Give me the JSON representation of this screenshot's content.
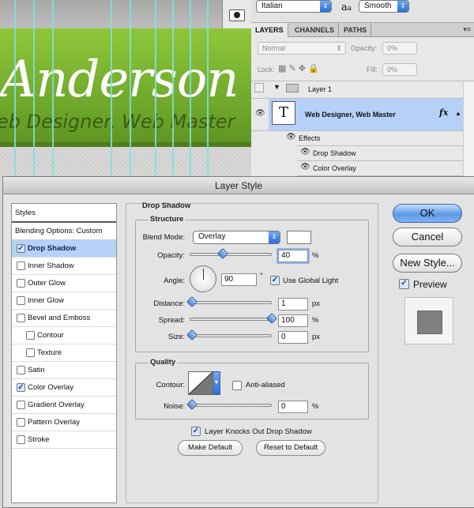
{
  "canvas": {
    "name_text": "Anderson",
    "subtitle_text": "eb Designer, Web Master"
  },
  "charbar": {
    "font_style": "Italian",
    "aa_symbol": "a",
    "aa_sub": "a",
    "antialias": "Smooth"
  },
  "layers_panel": {
    "tabs": [
      "LAYERS",
      "CHANNELS",
      "PATHS"
    ],
    "blend_mode": "Normal",
    "opacity_label": "Opacity:",
    "opacity_value": "0%",
    "lock_label": "Lock:",
    "fill_label": "Fill:",
    "fill_value": "0%",
    "group_name": "Layer 1",
    "text_layer_name": "Web Designer, Web Master",
    "text_thumb": "T",
    "fx_label": "fx",
    "effects_label": "Effects",
    "effect_items": [
      "Drop Shadow",
      "Color Overlay"
    ]
  },
  "dialog": {
    "title": "Layer Style",
    "styles_header": "Styles",
    "blending_options": "Blending Options: Custom",
    "style_items": [
      {
        "label": "Drop Shadow",
        "checked": true,
        "selected": true
      },
      {
        "label": "Inner Shadow",
        "checked": false
      },
      {
        "label": "Outer Glow",
        "checked": false
      },
      {
        "label": "Inner Glow",
        "checked": false
      },
      {
        "label": "Bevel and Emboss",
        "checked": false
      },
      {
        "label": "Contour",
        "checked": false
      },
      {
        "label": "Texture",
        "checked": false
      },
      {
        "label": "Satin",
        "checked": false
      },
      {
        "label": "Color Overlay",
        "checked": true
      },
      {
        "label": "Gradient Overlay",
        "checked": false
      },
      {
        "label": "Pattern Overlay",
        "checked": false
      },
      {
        "label": "Stroke",
        "checked": false
      }
    ],
    "section_title": "Drop Shadow",
    "structure_title": "Structure",
    "blend_mode_label": "Blend Mode:",
    "blend_mode_value": "Overlay",
    "opacity_label": "Opacity:",
    "opacity_value": "40",
    "opacity_fraction": 0.4,
    "angle_label": "Angle:",
    "angle_value": "90",
    "degree_sign": "°",
    "use_global_light": "Use Global Light",
    "distance_label": "Distance:",
    "distance_value": "1",
    "spread_label": "Spread:",
    "spread_value": "100",
    "size_label": "Size:",
    "size_value": "0",
    "unit_percent": "%",
    "unit_px": "px",
    "quality_title": "Quality",
    "contour_label": "Contour:",
    "anti_aliased": "Anti-aliased",
    "noise_label": "Noise:",
    "noise_value": "0",
    "knocks_out": "Layer Knocks Out Drop Shadow",
    "make_default": "Make Default",
    "reset_default": "Reset to Default",
    "ok": "OK",
    "cancel": "Cancel",
    "new_style": "New Style...",
    "preview": "Preview"
  }
}
